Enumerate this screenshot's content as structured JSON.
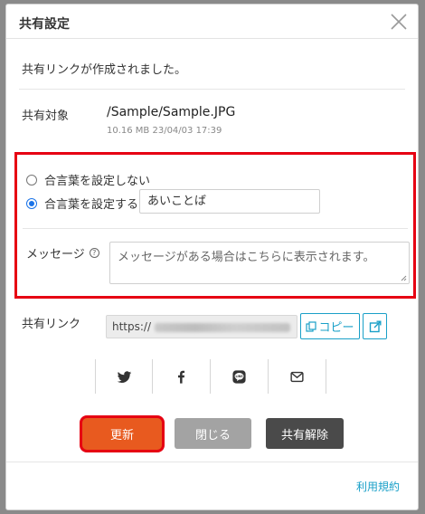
{
  "dialog": {
    "title": "共有設定",
    "created_message": "共有リンクが作成されました。"
  },
  "target": {
    "label": "共有対象",
    "path": "/Sample/Sample.JPG",
    "meta": "10.16 MB 23/04/03 17:39"
  },
  "password": {
    "option_none": "合言葉を設定しない",
    "option_set": "合言葉を設定する",
    "selected": "option_set",
    "value": "あいことば"
  },
  "message": {
    "label": "メッセージ",
    "help_icon": "question-circle-icon",
    "placeholder": "メッセージがある場合はこちらに表示されます。"
  },
  "link": {
    "label": "共有リンク",
    "url_prefix": "https://",
    "copy_label": "コピー",
    "copy_icon": "copy-icon",
    "open_icon": "external-link-icon"
  },
  "social": [
    "twitter-icon",
    "facebook-icon",
    "line-icon",
    "mail-icon"
  ],
  "buttons": {
    "update": "更新",
    "close": "閉じる",
    "unshare": "共有解除"
  },
  "footer": {
    "terms": "利用規約"
  },
  "colors": {
    "accent": "#1aa0c8",
    "update": "#e85a1f",
    "highlight": "#e60012",
    "close_btn": "#a3a3a3",
    "unshare_btn": "#4a4a4a"
  }
}
